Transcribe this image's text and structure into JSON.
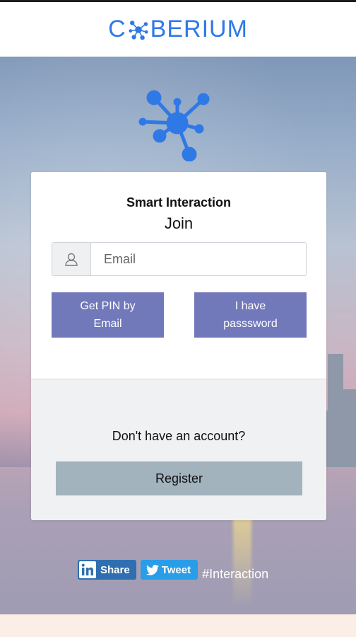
{
  "header": {
    "brand_prefix": "C",
    "brand_suffix": "BERIUM",
    "logo_icon": "network-hub-icon"
  },
  "colors": {
    "brand_blue": "#2f79e6",
    "button_purple": "#7279bb",
    "register_gray": "#a2b3bd",
    "linkedin_blue": "#2f6fb1",
    "twitter_blue": "#2a9de8"
  },
  "card": {
    "subtitle": "Smart Interaction",
    "title": "Join",
    "email": {
      "placeholder": "Email",
      "value": "",
      "icon": "user-icon"
    },
    "pin_button": {
      "line1": "Get PIN by",
      "line2": "Email"
    },
    "password_button": {
      "line1": "I have",
      "line2": "passsword"
    },
    "no_account_text": "Don't have an account?",
    "register_label": "Register"
  },
  "social": {
    "share_label": "Share",
    "tweet_label": "Tweet",
    "hashtag": "#Interaction"
  }
}
